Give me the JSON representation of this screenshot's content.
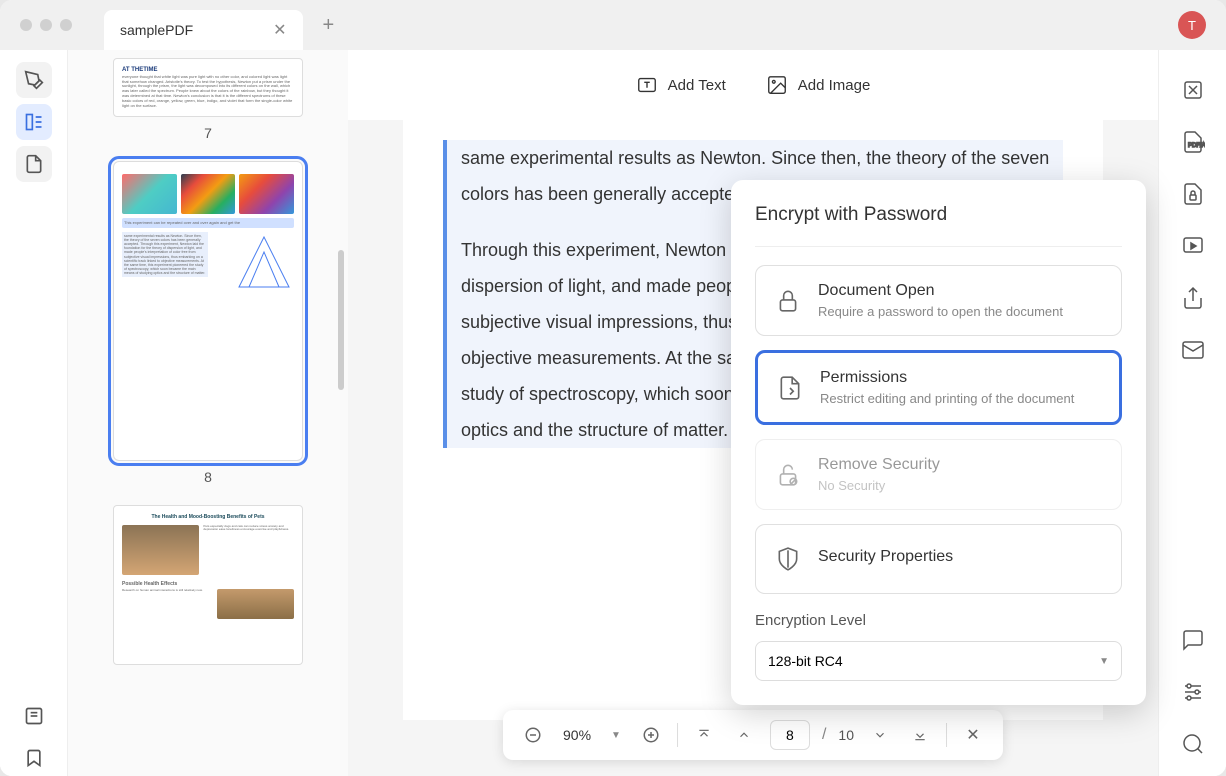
{
  "tab": {
    "title": "samplePDF",
    "avatar_letter": "T"
  },
  "toolbar": {
    "add_text": "Add Text",
    "add_image": "Add Image"
  },
  "thumbnails": {
    "p7": "7",
    "p8": "8"
  },
  "document": {
    "para1": "same experimental results as Newton. Since then, the theory of the seven colors has been generally accepted.",
    "para2": "Through this experiment, Newton laid the foundation for the theory of dispersion of light, and made people's interpretation of color free from subjective visual impressions, thus embarking on a scientific track linked to objective measurements. At the same time, this experiment pioneered the study of spectroscopy, which soon became the main means of studying optics and the structure of matter."
  },
  "controls": {
    "zoom": "90%",
    "current_page": "8",
    "total_pages": "10",
    "separator": "/"
  },
  "panel": {
    "title": "Encrypt with Password",
    "doc_open": {
      "title": "Document Open",
      "desc": "Require a password to open the document"
    },
    "permissions": {
      "title": "Permissions",
      "desc": "Restrict editing and printing of the document"
    },
    "remove": {
      "title": "Remove Security",
      "desc": "No Security"
    },
    "props": {
      "title": "Security Properties"
    },
    "enc_label": "Encryption Level",
    "enc_value": "128-bit RC4"
  },
  "thumb7": {
    "title": "AT THETIME",
    "body": "everyone thought that white light was pure light with no other color, and colored light was light that somehow changed. Aristotle's theory. To test the hypothesis, Newton put a prism under the sunlight, through the prism, the light was decomposed into its different colors on the wall, which was later called the spectrum. People knew about the colors of the rainbow, but they thought it was determined at that time. Newton's conclusion is that it is the different spectrums of these basic colors of red, orange, yellow, green, blue, indigo, and violet that form the single-color white light on the surface."
  },
  "thumb8": {
    "hl": "This experiment can be repeated over and over again and get the",
    "col": "same experimental results as Newton. Since then, the theory of the seven colors has been generally accepted. Through this experiment, Newton laid the foundation for the theory of dispersion of light, and made people's interpretation of color free from subjective visual impressions, thus embarking on a scientific track linked to objective measurements. At the same time, this experiment pioneered the study of spectroscopy, which soon became the main means of studying optics and the structure of matter."
  },
  "thumb9": {
    "title": "The Health and Mood-Boosting Benefits of Pets",
    "sub": "Possible Health Effects"
  }
}
